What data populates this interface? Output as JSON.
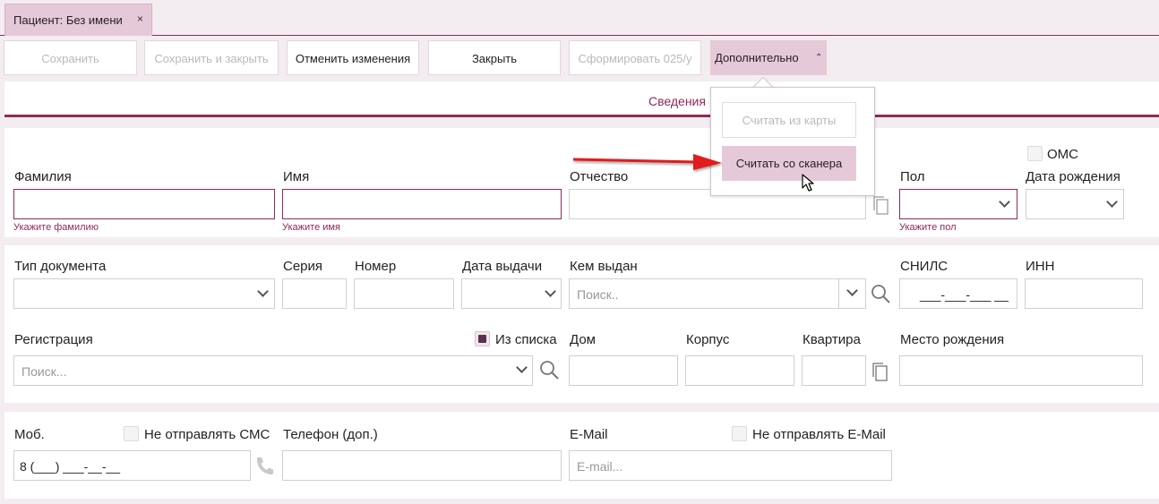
{
  "tab": {
    "title": "Пациент: Без имени",
    "close": "×"
  },
  "toolbar": {
    "save": "Сохранить",
    "save_close": "Сохранить и закрыть",
    "cancel": "Отменить изменения",
    "close": "Закрыть",
    "form025": "Сформировать 025/у",
    "more": "Дополнительно",
    "more_caret": "⌃"
  },
  "section": {
    "title": "Сведения"
  },
  "dropdown": {
    "read_card": "Считать из карты",
    "read_scanner": "Считать со сканера"
  },
  "identity": {
    "oms_label": "ОМС",
    "surname_label": "Фамилия",
    "surname_hint": "Укажите фамилию",
    "name_label": "Имя",
    "name_hint": "Укажите имя",
    "patronymic_label": "Отчество",
    "sex_label": "Пол",
    "sex_hint": "Укажите пол",
    "birthdate_label": "Дата рождения"
  },
  "document": {
    "type_label": "Тип документа",
    "series_label": "Серия",
    "number_label": "Номер",
    "issue_date_label": "Дата выдачи",
    "issued_by_label": "Кем выдан",
    "issued_by_placeholder": "Поиск..",
    "snils_label": "СНИЛС",
    "snils_mask": "___-___-___ __",
    "inn_label": "ИНН"
  },
  "address": {
    "registration_label": "Регистрация",
    "from_list_label": "Из списка",
    "from_list_checked": true,
    "registration_placeholder": "Поиск...",
    "house_label": "Дом",
    "building_label": "Корпус",
    "apartment_label": "Квартира",
    "birthplace_label": "Место рождения"
  },
  "contacts": {
    "mobile_label": "Моб.",
    "no_sms_label": "Не отправлять СМС",
    "mobile_value": "8 (___) ___-__-__",
    "phone2_label": "Телефон (доп.)",
    "email_label": "E-Mail",
    "no_email_label": "Не отправлять E-Mail",
    "email_placeholder": "E-mail..."
  },
  "colors": {
    "accent": "#8e2a58",
    "accent_light": "#e6c9d8",
    "background": "#f3ecf0",
    "arrow": "#e01b1b"
  }
}
